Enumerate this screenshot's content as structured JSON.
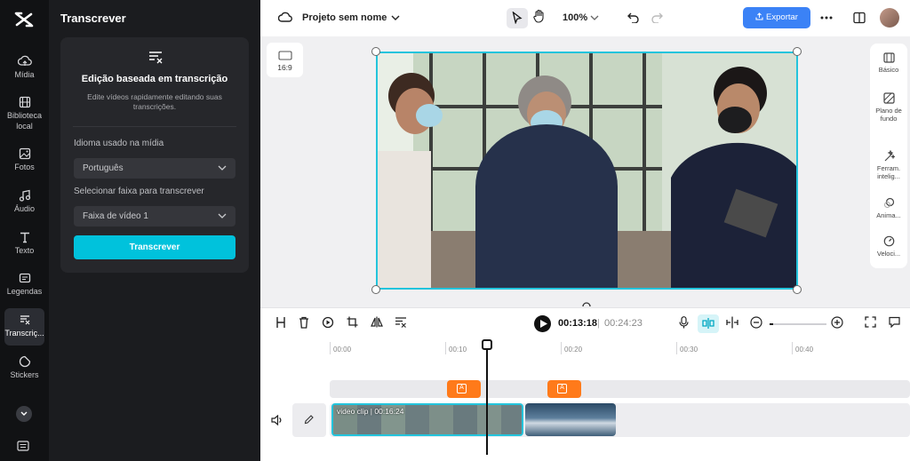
{
  "left_nav": {
    "items": [
      {
        "label": "Mídia",
        "icon": "cloud-upload-icon"
      },
      {
        "label": "Biblioteca local",
        "icon": "film-icon"
      },
      {
        "label": "Fotos",
        "icon": "image-icon"
      },
      {
        "label": "Áudio",
        "icon": "music-icon"
      },
      {
        "label": "Texto",
        "icon": "text-icon"
      },
      {
        "label": "Legendas",
        "icon": "captions-icon"
      },
      {
        "label": "Transcriç...",
        "icon": "transcript-icon"
      },
      {
        "label": "Stickers",
        "icon": "sticker-icon"
      }
    ]
  },
  "panel": {
    "title": "Transcrever",
    "card_title": "Edição baseada em transcrição",
    "card_desc": "Edite vídeos rapidamente editando suas transcrições.",
    "language_label": "Idioma usado na mídia",
    "language_value": "Português",
    "track_label": "Selecionar faixa para transcrever",
    "track_value": "Faixa de vídeo 1",
    "transcribe_button": "Transcrever"
  },
  "topbar": {
    "project_name": "Projeto sem nome",
    "zoom": "100%",
    "export_label": "Exportar"
  },
  "canvas": {
    "aspect_ratio": "16:9"
  },
  "right_panel": {
    "items": [
      {
        "label": "Básico",
        "icon": "basic-icon"
      },
      {
        "label": "Plano de fundo",
        "icon": "background-icon"
      },
      {
        "label": "Ferram. intelig...",
        "icon": "smart-tools-icon"
      },
      {
        "label": "Anima...",
        "icon": "animation-icon"
      },
      {
        "label": "Veloci...",
        "icon": "speed-icon"
      }
    ]
  },
  "player": {
    "current_time": "00:13:18",
    "separator": "|",
    "total_time": "00:24:23"
  },
  "timeline": {
    "ticks": [
      "00:00",
      "00:10",
      "00:20",
      "00:30",
      "00:40"
    ],
    "clip1_label": "video clip",
    "clip1_duration": "00:16:24"
  },
  "colors": {
    "accent": "#00c2dc",
    "export": "#3b82f6",
    "marker": "#ff7a1a",
    "nav_bg": "#111214",
    "panel_bg": "#1b1c1f"
  }
}
